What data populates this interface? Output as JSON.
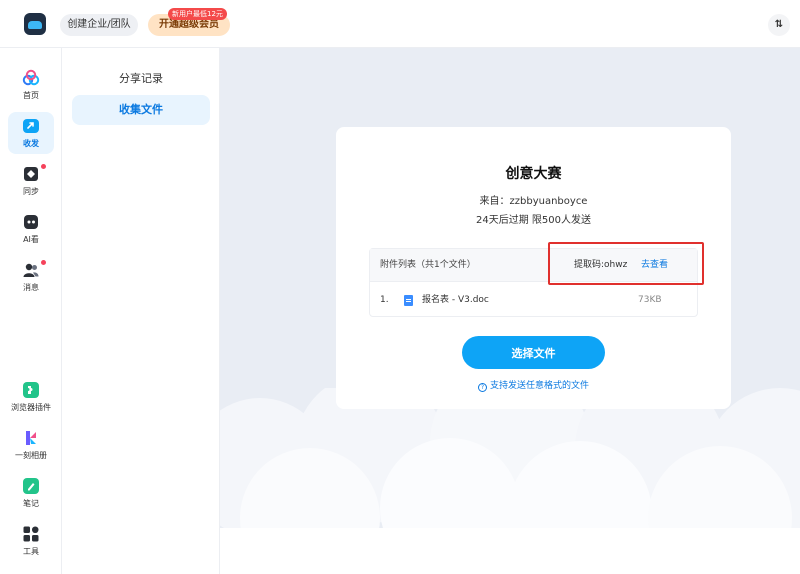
{
  "header": {
    "team_label": "创建企业/团队",
    "vip_label": "开通超级会员",
    "vip_badge": "新用户最低12元",
    "sort_glyph": "⇅"
  },
  "leftnav": {
    "items": [
      {
        "label": "首页",
        "icon": "cloud-logo-icon"
      },
      {
        "label": "收发",
        "icon": "share-box-icon",
        "active": true
      },
      {
        "label": "同步",
        "icon": "sync-icon",
        "dot": true
      },
      {
        "label": "AI看",
        "icon": "ai-icon"
      },
      {
        "label": "消息",
        "icon": "people-icon",
        "dot": true
      },
      {
        "label": "浏览器插件",
        "icon": "puzzle-icon"
      },
      {
        "label": "一刻相册",
        "icon": "photo-album-icon"
      },
      {
        "label": "笔记",
        "icon": "note-icon"
      },
      {
        "label": "工具",
        "icon": "grid-tools-icon"
      }
    ]
  },
  "subnav": {
    "items": [
      {
        "label": "分享记录"
      },
      {
        "label": "收集文件",
        "active": true
      }
    ]
  },
  "card": {
    "title": "创意大赛",
    "from": "来自：zzbbyuanboyce",
    "expiry": "24天后过期  限500人发送",
    "files_header": "附件列表（共1个文件）",
    "code_label": "提取码:ohwz",
    "view_link": "去查看",
    "files": [
      {
        "index": "1.",
        "name": "报名表 - V3.doc",
        "size": "73KB"
      }
    ],
    "choose_button": "选择文件",
    "support_text": "支持发送任意格式的文件",
    "help_glyph": "?"
  },
  "colors": {
    "accent": "#0ea4f6",
    "link": "#0b79e0",
    "highlight_box": "#e0302d",
    "dot": "#f5425b"
  }
}
